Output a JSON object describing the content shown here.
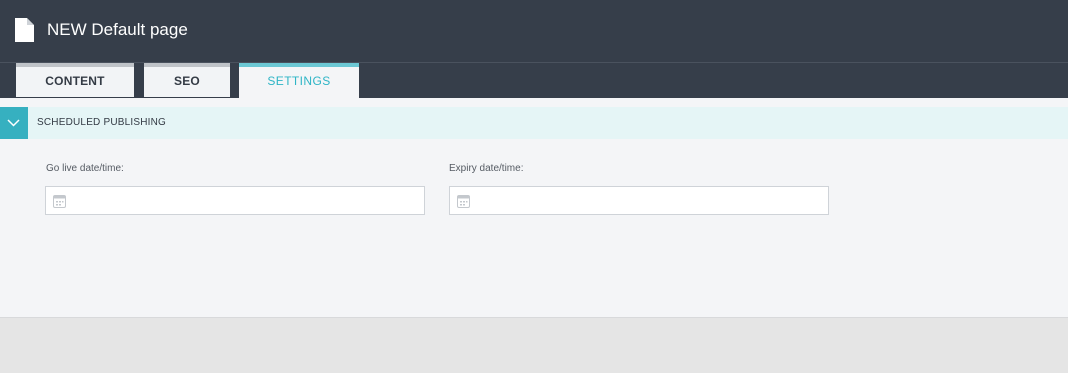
{
  "header": {
    "title": "NEW Default page",
    "icon": "document-icon"
  },
  "tabs": [
    {
      "label": "CONTENT",
      "active": false
    },
    {
      "label": "SEO",
      "active": false
    },
    {
      "label": "SETTINGS",
      "active": true
    }
  ],
  "section": {
    "title": "SCHEDULED PUBLISHING",
    "expanded": true,
    "toggle_icon": "chevron-down-icon"
  },
  "fields": {
    "go_live": {
      "label": "Go live date/time:",
      "value": "",
      "icon": "calendar-icon"
    },
    "expiry": {
      "label": "Expiry date/time:",
      "value": "",
      "icon": "calendar-icon"
    }
  },
  "colors": {
    "header_bg": "#363e4a",
    "accent": "#36b0c0",
    "section_bg": "#e5f5f6",
    "content_bg": "#f4f5f7"
  }
}
